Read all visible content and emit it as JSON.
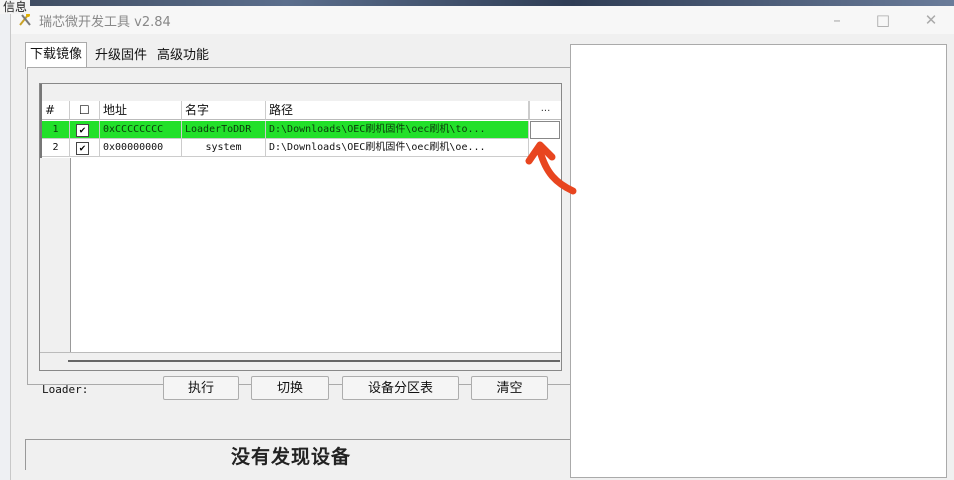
{
  "corner_text": "信息",
  "window": {
    "title": "瑞芯微开发工具 v2.84",
    "controls": {
      "minimize": "–",
      "maximize": "□",
      "close": "✕"
    }
  },
  "tabs": [
    {
      "label": "下载镜像",
      "active": true
    },
    {
      "label": "升级固件",
      "active": false
    },
    {
      "label": "高级功能",
      "active": false
    }
  ],
  "table": {
    "headers": {
      "num": "#",
      "check": "☐",
      "address": "地址",
      "name": "名字",
      "path": "路径",
      "more": "..."
    },
    "rows": [
      {
        "num": "1",
        "checked": "✔",
        "address": "0xCCCCCCCC",
        "name": "LoaderToDDR",
        "path": "D:\\Downloads\\OEC刷机固件\\oec刷机\\to...",
        "selected": true
      },
      {
        "num": "2",
        "checked": "✔",
        "address": "0x00000000",
        "name": "system",
        "path": "D:\\Downloads\\OEC刷机固件\\oec刷机\\oe...",
        "selected": false
      }
    ]
  },
  "loader_label": "Loader:",
  "buttons": {
    "execute": "执行",
    "switch": "切换",
    "partition_table": "设备分区表",
    "clear": "清空"
  },
  "status": "没有发现设备",
  "colors": {
    "selected_row": "#22e02a",
    "annotation_arrow": "#e8451f"
  },
  "icons": [
    "app-icon",
    "minimize-icon",
    "maximize-icon",
    "close-icon",
    "checkbox-icon",
    "annotation-arrow-icon"
  ]
}
